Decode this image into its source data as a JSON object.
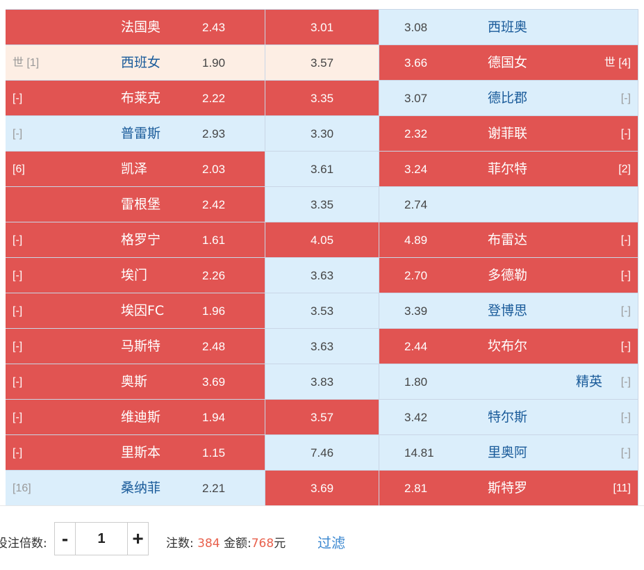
{
  "matches": [
    {
      "home_rank": "",
      "home": "法国奥",
      "home_odd": "2.43",
      "draw_odd": "3.01",
      "away_odd": "3.08",
      "away": "西班奥",
      "away_rank": ""
    },
    {
      "home_rank": "世 [1]",
      "home": "西班女",
      "home_odd": "1.90",
      "draw_odd": "3.57",
      "away_odd": "3.66",
      "away": "德国女",
      "away_rank": "世 [4]"
    },
    {
      "home_rank": "[-]",
      "home": "布莱克",
      "home_odd": "2.22",
      "draw_odd": "3.35",
      "away_odd": "3.07",
      "away": "德比郡",
      "away_rank": "[-]"
    },
    {
      "home_rank": "[-]",
      "home": "普雷斯",
      "home_odd": "2.93",
      "draw_odd": "3.30",
      "away_odd": "2.32",
      "away": "谢菲联",
      "away_rank": "[-]"
    },
    {
      "home_rank": "[6]",
      "home": "凯泽",
      "home_odd": "2.03",
      "draw_odd": "3.61",
      "away_odd": "3.24",
      "away": "菲尔特",
      "away_rank": "[2]"
    },
    {
      "home_rank": "",
      "home": "雷根堡",
      "home_odd": "2.42",
      "draw_odd": "3.35",
      "away_odd": "2.74",
      "away": "",
      "away_rank": ""
    },
    {
      "home_rank": "[-]",
      "home": "格罗宁",
      "home_odd": "1.61",
      "draw_odd": "4.05",
      "away_odd": "4.89",
      "away": "布雷达",
      "away_rank": "[-]"
    },
    {
      "home_rank": "[-]",
      "home": "埃门",
      "home_odd": "2.26",
      "draw_odd": "3.63",
      "away_odd": "2.70",
      "away": "多德勒",
      "away_rank": "[-]"
    },
    {
      "home_rank": "[-]",
      "home": "埃因FC",
      "home_odd": "1.96",
      "draw_odd": "3.53",
      "away_odd": "3.39",
      "away": "登博思",
      "away_rank": "[-]"
    },
    {
      "home_rank": "[-]",
      "home": "马斯特",
      "home_odd": "2.48",
      "draw_odd": "3.63",
      "away_odd": "2.44",
      "away": "坎布尔",
      "away_rank": "[-]"
    },
    {
      "home_rank": "[-]",
      "home": "奥斯",
      "home_odd": "3.69",
      "draw_odd": "3.83",
      "away_odd": "1.80",
      "away": "精英",
      "away_rank": "[-]"
    },
    {
      "home_rank": "[-]",
      "home": "维迪斯",
      "home_odd": "1.94",
      "draw_odd": "3.57",
      "away_odd": "3.42",
      "away": "特尔斯",
      "away_rank": "[-]"
    },
    {
      "home_rank": "[-]",
      "home": "里斯本",
      "home_odd": "1.15",
      "draw_odd": "7.46",
      "away_odd": "14.81",
      "away": "里奥阿",
      "away_rank": "[-]"
    },
    {
      "home_rank": "[16]",
      "home": "桑纳菲",
      "home_odd": "2.21",
      "draw_odd": "3.69",
      "away_odd": "2.81",
      "away": "斯特罗",
      "away_rank": "[11]"
    }
  ],
  "selection": [
    {
      "home": "selected",
      "draw": "selected",
      "away": "open"
    },
    {
      "home": "highlight",
      "draw": "highlight",
      "away": "selected"
    },
    {
      "home": "selected",
      "draw": "selected",
      "away": "open"
    },
    {
      "home": "open",
      "draw": "open",
      "away": "selected"
    },
    {
      "home": "selected",
      "draw": "open",
      "away": "selected"
    },
    {
      "home": "selected",
      "draw": "open",
      "away": "open"
    },
    {
      "home": "selected",
      "draw": "selected",
      "away": "selected"
    },
    {
      "home": "selected",
      "draw": "open",
      "away": "selected"
    },
    {
      "home": "selected",
      "draw": "open",
      "away": "open"
    },
    {
      "home": "selected",
      "draw": "open",
      "away": "selected"
    },
    {
      "home": "selected",
      "draw": "open",
      "away": "open"
    },
    {
      "home": "selected",
      "draw": "selected",
      "away": "open"
    },
    {
      "home": "selected",
      "draw": "open",
      "away": "open"
    },
    {
      "home": "open",
      "draw": "selected",
      "away": "selected"
    }
  ],
  "colors": {
    "selected": "#e15452",
    "open": "#dbeefb",
    "highlight": "#fdeee4",
    "stat_number": "#e8604c",
    "link": "#3a87d0"
  },
  "footer": {
    "multiplier_label": "投注倍数:",
    "minus_label": "-",
    "multiplier_value": "1",
    "plus_label": "+",
    "bets_label": "注数:",
    "bets_count": "384",
    "amount_label": "金额:",
    "amount_value": "768",
    "currency": "元",
    "filter_label": "过滤"
  }
}
